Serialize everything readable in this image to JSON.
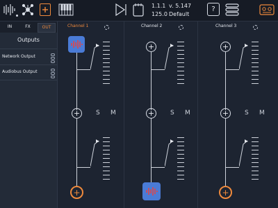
{
  "app": {
    "version_label": "v. 5.147",
    "position": "1.1.1",
    "tempo": "125.0",
    "preset": "Default"
  },
  "icons": {
    "waveform": "waveform-icon",
    "nodes": "nodes-icon",
    "add_box": "add-box-icon",
    "keyboard": "keyboard-icon",
    "play": "play-icon",
    "notepad": "notepad-icon",
    "help": "help-icon",
    "menu": "menu-icon",
    "cassette": "cassette-icon"
  },
  "toolbar": {
    "help_label": "?"
  },
  "colors": {
    "accent": "#f08a3c",
    "background": "#1d2431",
    "panel": "#232b38"
  },
  "side_panel": {
    "tabs": [
      {
        "label": "IN",
        "active": false
      },
      {
        "label": "FX",
        "active": false
      },
      {
        "label": "OUT",
        "active": true
      }
    ],
    "section_title": "Outputs",
    "items": [
      {
        "label": "Network Output"
      },
      {
        "label": "Audiobus Output"
      }
    ]
  },
  "channels": [
    {
      "name": "Channel 1",
      "highlighted": true,
      "solo_label": "S",
      "mute_label": "M",
      "footer_label": ""
    },
    {
      "name": "Channel 2",
      "highlighted": false,
      "solo_label": "S",
      "mute_label": "M",
      "footer_label": ""
    },
    {
      "name": "Channel 3",
      "highlighted": false,
      "solo_label": "S",
      "mute_label": "M",
      "footer_label": ""
    }
  ],
  "plus_label": "+"
}
